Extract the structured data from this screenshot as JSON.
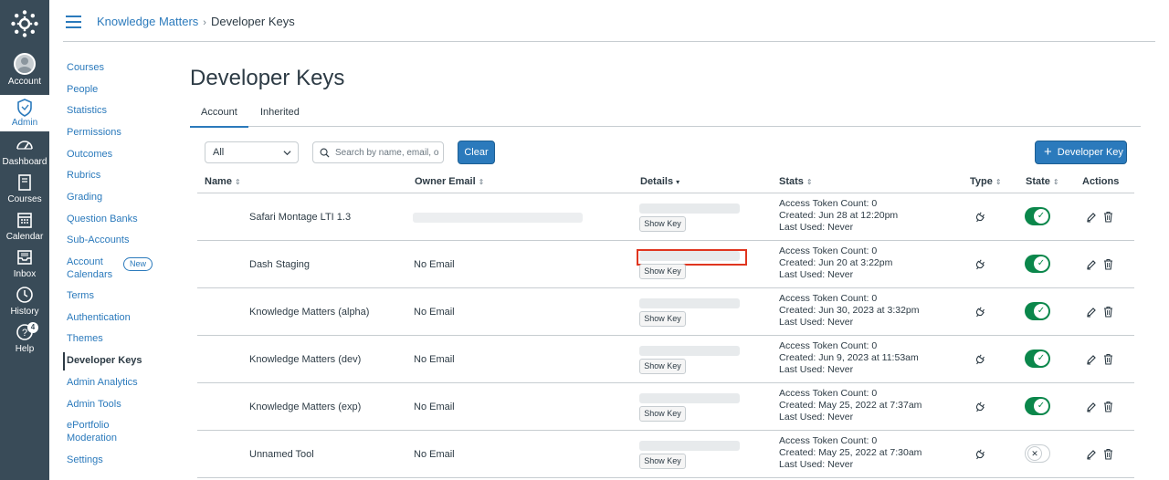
{
  "global_nav": {
    "items": [
      {
        "label": "Account",
        "icon": "avatar-icon"
      },
      {
        "label": "Admin",
        "icon": "shield-icon"
      },
      {
        "label": "Dashboard",
        "icon": "dashboard-icon"
      },
      {
        "label": "Courses",
        "icon": "book-icon"
      },
      {
        "label": "Calendar",
        "icon": "calendar-icon"
      },
      {
        "label": "Inbox",
        "icon": "inbox-icon"
      },
      {
        "label": "History",
        "icon": "clock-icon"
      },
      {
        "label": "Help",
        "icon": "help-icon",
        "badge": "4"
      }
    ]
  },
  "breadcrumb": {
    "parent": "Knowledge Matters",
    "separator": "›",
    "current": "Developer Keys"
  },
  "course_nav": {
    "items": [
      {
        "label": "Courses"
      },
      {
        "label": "People"
      },
      {
        "label": "Statistics"
      },
      {
        "label": "Permissions"
      },
      {
        "label": "Outcomes"
      },
      {
        "label": "Rubrics"
      },
      {
        "label": "Grading"
      },
      {
        "label": "Question Banks"
      },
      {
        "label": "Sub-Accounts"
      },
      {
        "label": "Account Calendars",
        "line1": "Account",
        "line2": "Calendars",
        "badge": "New"
      },
      {
        "label": "Terms"
      },
      {
        "label": "Authentication"
      },
      {
        "label": "Themes"
      },
      {
        "label": "Developer Keys",
        "active": true
      },
      {
        "label": "Admin Analytics"
      },
      {
        "label": "Admin Tools"
      },
      {
        "label": "ePortfolio Moderation",
        "line1": "ePortfolio",
        "line2": "Moderation"
      },
      {
        "label": "Settings"
      }
    ]
  },
  "page": {
    "title": "Developer Keys",
    "tabs": [
      {
        "label": "Account",
        "active": true
      },
      {
        "label": "Inherited",
        "active": false
      }
    ]
  },
  "filters": {
    "select_value": "All",
    "search_placeholder": "Search by name, email, o",
    "clear_label": "Clear",
    "add_label": "Developer Key"
  },
  "table": {
    "columns": [
      {
        "label": "Name",
        "sort": "⇕"
      },
      {
        "label": "Owner Email",
        "sort": "⇕"
      },
      {
        "label": "Details",
        "sort": "▾"
      },
      {
        "label": "Stats",
        "sort": "⇕"
      },
      {
        "label": "Type",
        "sort": "⇕"
      },
      {
        "label": "State",
        "sort": "⇕"
      },
      {
        "label": "Actions",
        "sort": ""
      }
    ],
    "show_key_label": "Show Key",
    "rows": [
      {
        "name": "Safari Montage LTI 1.3",
        "email": "",
        "email_redacted": true,
        "highlighted": false,
        "stats": [
          "Access Token Count: 0",
          "Created: Jun 28 at 12:20pm",
          "Last Used: Never"
        ],
        "state": "on"
      },
      {
        "name": "Dash Staging",
        "email": "No Email",
        "email_redacted": false,
        "highlighted": true,
        "stats": [
          "Access Token Count: 0",
          "Created: Jun 20 at 3:22pm",
          "Last Used: Never"
        ],
        "state": "on"
      },
      {
        "name": "Knowledge Matters (alpha)",
        "email": "No Email",
        "email_redacted": false,
        "highlighted": false,
        "stats": [
          "Access Token Count: 0",
          "Created: Jun 30, 2023 at 3:32pm",
          "Last Used: Never"
        ],
        "state": "on"
      },
      {
        "name": "Knowledge Matters (dev)",
        "email": "No Email",
        "email_redacted": false,
        "highlighted": false,
        "stats": [
          "Access Token Count: 0",
          "Created: Jun 9, 2023 at 11:53am",
          "Last Used: Never"
        ],
        "state": "on"
      },
      {
        "name": "Knowledge Matters (exp)",
        "email": "No Email",
        "email_redacted": false,
        "highlighted": false,
        "stats": [
          "Access Token Count: 0",
          "Created: May 25, 2022 at 7:37am",
          "Last Used: Never"
        ],
        "state": "on"
      },
      {
        "name": "Unnamed Tool",
        "email": "No Email",
        "email_redacted": false,
        "highlighted": false,
        "stats": [
          "Access Token Count: 0",
          "Created: May 25, 2022 at 7:30am",
          "Last Used: Never"
        ],
        "state": "off"
      }
    ]
  },
  "colors": {
    "nav_bg": "#394b58",
    "link": "#2b7abc",
    "toggle_on": "#0b874b",
    "highlight": "#e0351f"
  }
}
